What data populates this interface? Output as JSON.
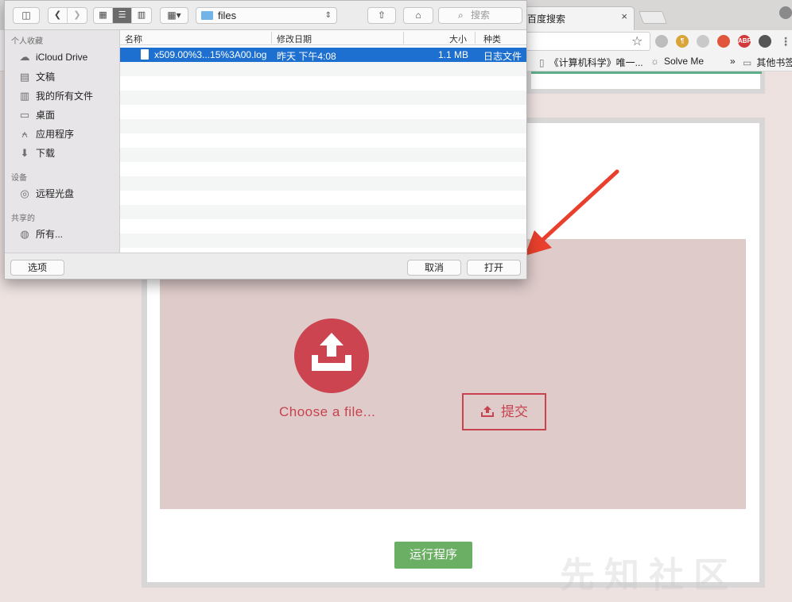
{
  "browser": {
    "active_tab_title": "百度搜索",
    "tab_close": "×",
    "bookmarks": [
      {
        "label": "《计算机科学》唯一...",
        "icon": "page-icon"
      },
      {
        "label": "Solve Me",
        "icon": "sun-icon"
      },
      {
        "label": "»",
        "icon": ""
      },
      {
        "label": "其他书签",
        "icon": "folder-icon"
      }
    ],
    "extensions": [
      {
        "name": "ext-icon-1",
        "color": "#bdbdbd",
        "text": ""
      },
      {
        "name": "pilcrow-icon",
        "color": "#d9a53a",
        "text": "¶"
      },
      {
        "name": "parachute-icon",
        "color": "#c9c9c9",
        "text": ""
      },
      {
        "name": "hand-icon",
        "color": "#e0553b",
        "text": ""
      },
      {
        "name": "adblock-icon",
        "color": "#d23a3a",
        "text": "ABP"
      },
      {
        "name": "evernote-icon",
        "color": "#555555",
        "text": ""
      },
      {
        "name": "menu-icon",
        "color": "#777777",
        "text": "⋮"
      }
    ]
  },
  "dialog": {
    "path_folder": "files",
    "search_placeholder": "搜索",
    "sidebar": {
      "favorites_head": "个人收藏",
      "favorites": [
        {
          "label": "iCloud Drive",
          "icon": "cloud-icon"
        },
        {
          "label": "文稿",
          "icon": "documents-icon"
        },
        {
          "label": "我的所有文件",
          "icon": "all-files-icon"
        },
        {
          "label": "桌面",
          "icon": "desktop-icon"
        },
        {
          "label": "应用程序",
          "icon": "applications-icon"
        },
        {
          "label": "下载",
          "icon": "downloads-icon"
        }
      ],
      "devices_head": "设备",
      "devices": [
        {
          "label": "远程光盘",
          "icon": "disc-icon"
        }
      ],
      "shared_head": "共享的",
      "shared": [
        {
          "label": "所有...",
          "icon": "network-icon"
        }
      ]
    },
    "columns": {
      "name": "名称",
      "modified": "修改日期",
      "size": "大小",
      "kind": "种类"
    },
    "files": [
      {
        "name": "x509.00%3...15%3A00.log",
        "modified": "昨天 下午4:08",
        "size": "1.1 MB",
        "kind": "日志文件",
        "selected": true
      }
    ],
    "options_button": "选项",
    "cancel_button": "取消",
    "open_button": "打开"
  },
  "page": {
    "choose_label": "Choose a file...",
    "submit_label": "提交",
    "run_label": "运行程序",
    "accent_color": "#c8424f",
    "run_color": "#6aaf63"
  },
  "watermark": "先知社区"
}
